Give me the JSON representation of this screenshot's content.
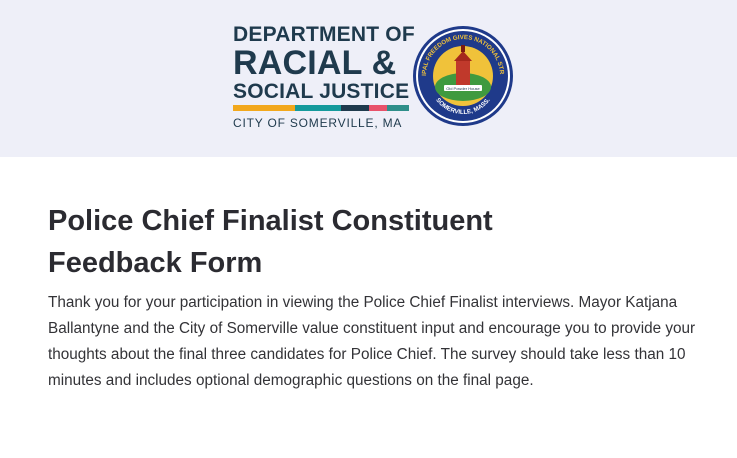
{
  "header": {
    "logo_line1": "DEPARTMENT OF",
    "logo_line2": "RACIAL &",
    "logo_line3": "SOCIAL JUSTICE",
    "logo_city": "CITY OF SOMERVILLE, MA",
    "seal_top_text": "MUNICIPAL FREEDOM GIVES NATIONAL STRENGTH",
    "seal_bottom_text": "SOMERVILLE, MASS.",
    "seal_banner_text": "Old Powder House",
    "stripe_colors": [
      "#f2a81d",
      "#f2a81d",
      "#159a9c",
      "#1f3a4d",
      "#e8526a",
      "#2f8f8a"
    ]
  },
  "form": {
    "title": "Police Chief Finalist Constituent Feedback Form",
    "intro": "Thank you for your participation in viewing the Police Chief Finalist interviews. Mayor Katjana Ballantyne and the City of Somerville value constituent input and encourage you to provide your thoughts about the final three candidates for Police Chief. The survey should take less than 10 minutes and includes optional demographic questions on the final page."
  }
}
